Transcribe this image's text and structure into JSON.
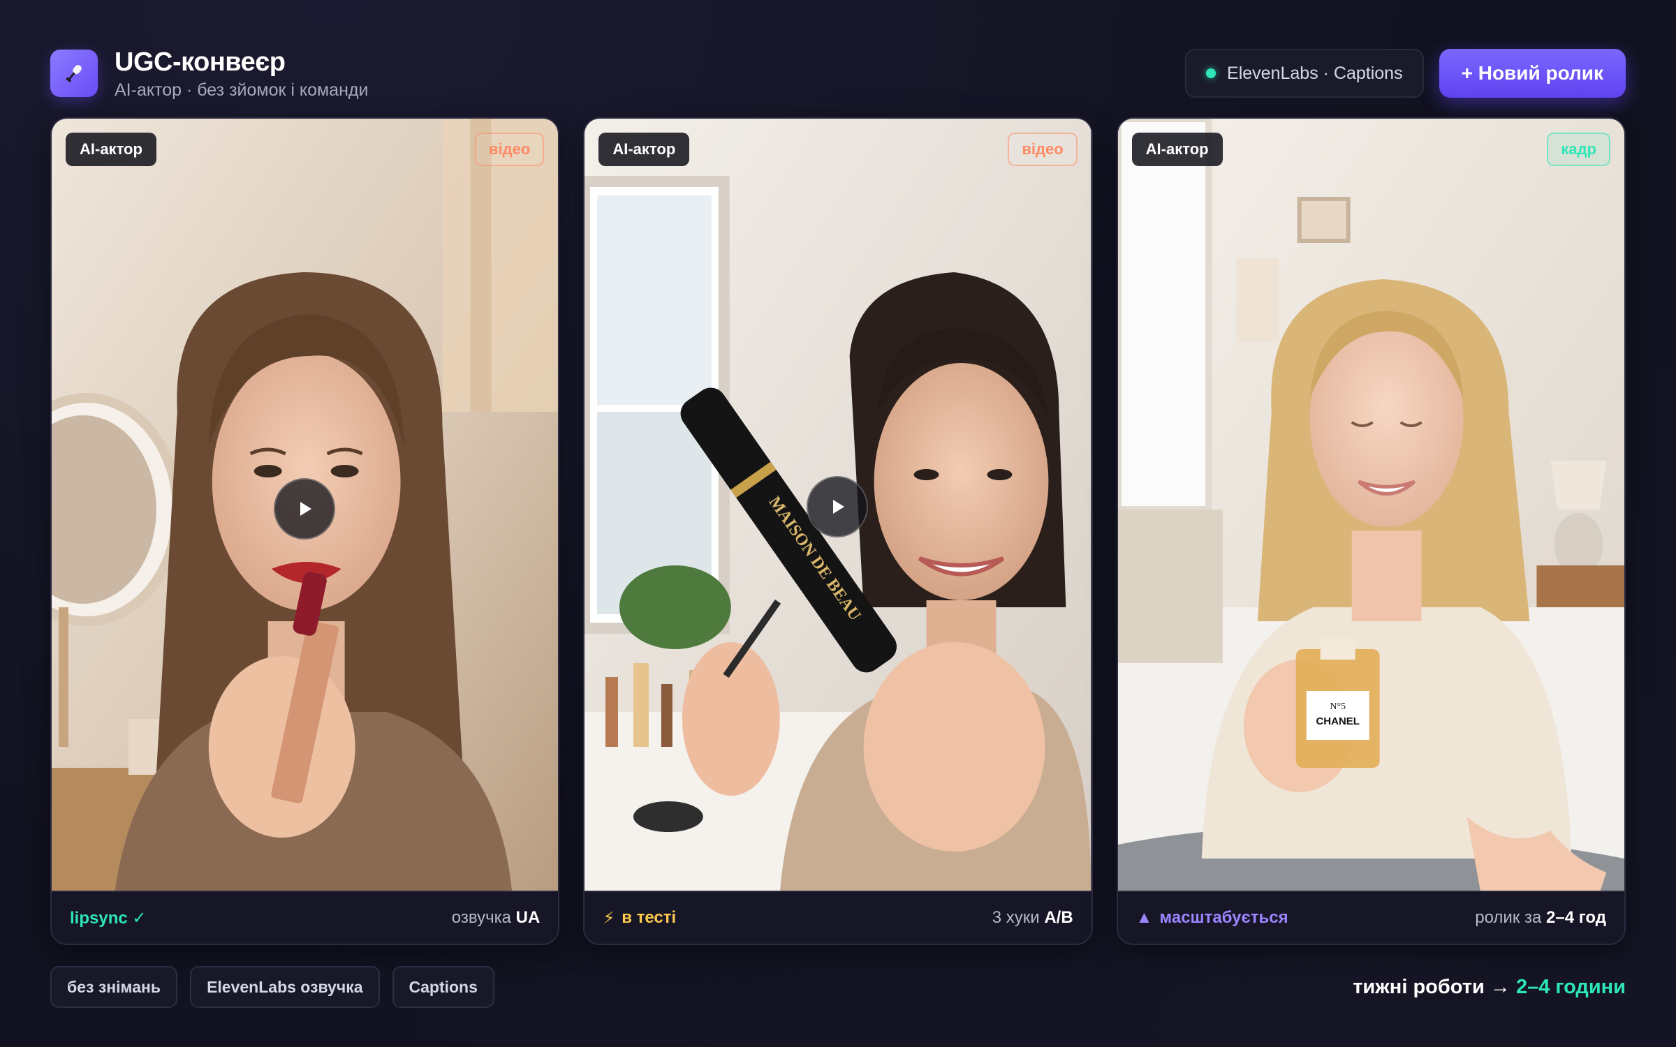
{
  "app": {
    "title": "UGC-конвеєр",
    "subtitle": "AI-актор · без зйомок і команди",
    "logo_icon": "microphone-icon"
  },
  "header": {
    "status_label": "ElevenLabs · Captions",
    "status_color": "#2ee6b8",
    "new_button": "+ Новий ролик",
    "accent": "#6a4cf5"
  },
  "cards": [
    {
      "badge": "AI-актор",
      "type_badge": "відео",
      "product": "lipstick",
      "footer_left": "lipsync ✓",
      "footer_right_prefix": "озвучка",
      "footer_right_value": "UA"
    },
    {
      "badge": "AI-актор",
      "type_badge": "відео",
      "product": "mascara",
      "product_text": "MAISON DE BEAU",
      "footer_icon": "⚡",
      "footer_left": "в тесті",
      "footer_right_prefix": "3 хуки",
      "footer_right_value": "A/B"
    },
    {
      "badge": "AI-актор",
      "type_badge": "кадр",
      "product": "perfume",
      "product_text": "CHANEL",
      "product_subtext": "N°5",
      "footer_icon": "▲",
      "footer_left": "масштабується",
      "footer_right_prefix": "ролик за",
      "footer_right_value": "2–4 год"
    }
  ],
  "tags": [
    "без знімань",
    "ElevenLabs озвучка",
    "Captions"
  ],
  "tagline": {
    "prefix": "тижні роботи →",
    "highlight": "2–4 години"
  }
}
